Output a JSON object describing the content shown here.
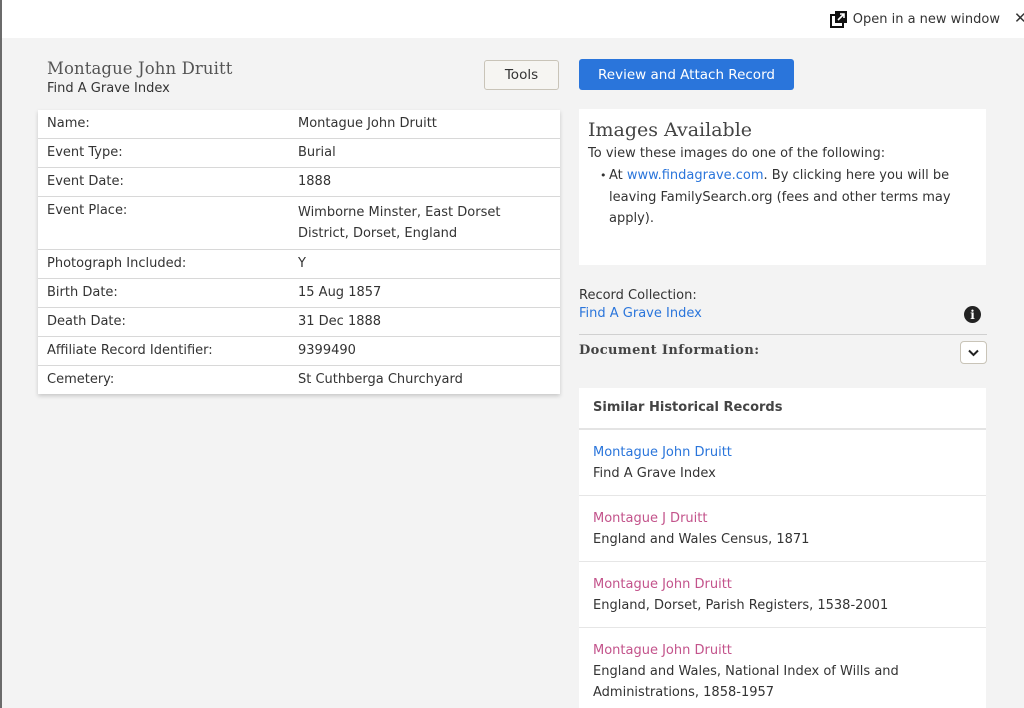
{
  "topbar": {
    "open_new_window_label": "Open in a new window",
    "close_label": "✕"
  },
  "record": {
    "title": "Montague John Druitt",
    "subtitle": "Find A Grave Index"
  },
  "buttons": {
    "tools": "Tools",
    "review_attach": "Review and Attach Record"
  },
  "fields": [
    {
      "label": "Name:",
      "value": "Montague John Druitt"
    },
    {
      "label": "Event Type:",
      "value": "Burial"
    },
    {
      "label": "Event Date:",
      "value": "1888"
    },
    {
      "label": "Event Place:",
      "value": "Wimborne Minster, East Dorset District, Dorset, England"
    },
    {
      "label": "Photograph Included:",
      "value": "Y"
    },
    {
      "label": "Birth Date:",
      "value": "15 Aug 1857"
    },
    {
      "label": "Death Date:",
      "value": "31 Dec 1888"
    },
    {
      "label": "Affiliate Record Identifier:",
      "value": "9399490"
    },
    {
      "label": "Cemetery:",
      "value": "St Cuthberga Churchyard"
    }
  ],
  "images": {
    "title": "Images Available",
    "description": "To view these images do one of the following:",
    "item_prefix": "At ",
    "item_link": "www.findagrave.com",
    "item_suffix": ". By clicking here you will be leaving FamilySearch.org (fees and other terms may apply)."
  },
  "collection": {
    "label": "Record Collection:",
    "link": "Find A Grave Index"
  },
  "document_info": {
    "label": "Document Information:"
  },
  "similar": {
    "heading": "Similar Historical Records",
    "items": [
      {
        "name": "Montague John Druitt",
        "collection": "Find A Grave Index"
      },
      {
        "name": "Montague J Druitt",
        "collection": "England and Wales Census, 1871"
      },
      {
        "name": "Montague John Druitt",
        "collection": "England, Dorset, Parish Registers, 1538-2001"
      },
      {
        "name": "Montague John Druitt",
        "collection": "England and Wales, National Index of Wills and Administrations, 1858-1957"
      }
    ]
  },
  "colors": {
    "primary_blue": "#2a75db",
    "visited_link": "#c3538b",
    "background": "#f3f3f3"
  }
}
